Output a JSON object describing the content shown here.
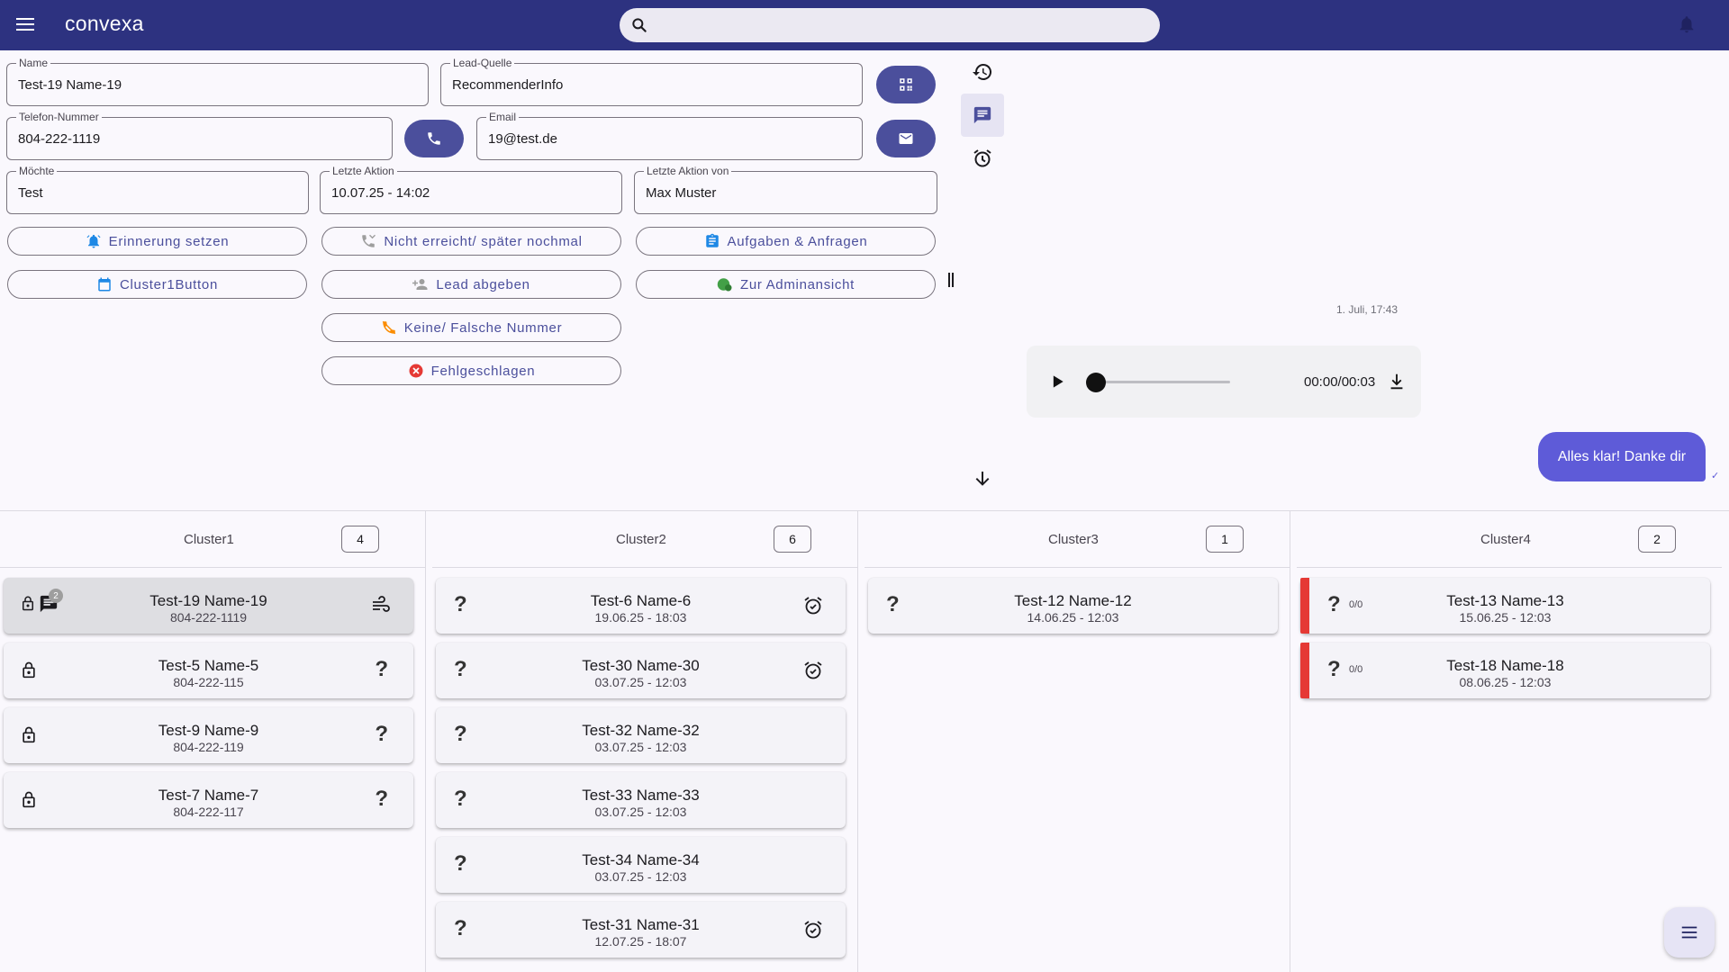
{
  "app": {
    "brand": "convexa"
  },
  "search": {
    "value": "",
    "placeholder": ""
  },
  "form": {
    "name_label": "Name",
    "name_value": "Test-19 Name-19",
    "lead_source_label": "Lead-Quelle",
    "lead_source_value": "RecommenderInfo",
    "phone_label": "Telefon-Nummer",
    "phone_value": "804-222-1119",
    "email_label": "Email",
    "email_value": "19@test.de",
    "wants_label": "Möchte",
    "wants_value": "Test",
    "last_action_label": "Letzte Aktion",
    "last_action_value": "10.07.25 - 14:02",
    "last_action_by_label": "Letzte Aktion von",
    "last_action_by_value": "Max Muster"
  },
  "actions": {
    "reminder": "Erinnerung setzen",
    "not_reached": "Nicht erreicht/ später nochmal",
    "tasks": "Aufgaben & Anfragen",
    "cluster1": "Cluster1Button",
    "hand_over": "Lead abgeben",
    "admin_view": "Zur Adminansicht",
    "wrong_number": "Keine/ Falsche Nummer",
    "failed": "Fehlgeschlagen"
  },
  "colors": {
    "reminder_icon": "#1e88e5",
    "tasks_icon": "#1e88e5",
    "calendar_icon": "#1e88e5",
    "admin_icon": "#43a047",
    "wrong_number_icon": "#fb8c00",
    "failed_icon": "#e53935",
    "primary": "#4b4f9c",
    "header": "#2d3280"
  },
  "chat": {
    "timestamp": "1. Juli, 17:43",
    "audio_time": "00:00/00:03",
    "audio_progress": 0,
    "message": "Alles klar! Danke dir",
    "read_mark": "✓"
  },
  "board": {
    "columns": [
      {
        "title": "Cluster1",
        "count": "4",
        "cards": [
          {
            "name": "Test-19 Name-19",
            "sub": "804-222-1119",
            "badge": "2"
          },
          {
            "name": "Test-5 Name-5",
            "sub": "804-222-115",
            "right": "?"
          },
          {
            "name": "Test-9 Name-9",
            "sub": "804-222-119",
            "right": "?"
          },
          {
            "name": "Test-7 Name-7",
            "sub": "804-222-117",
            "right": "?"
          }
        ]
      },
      {
        "title": "Cluster2",
        "count": "6",
        "cards": [
          {
            "left": "?",
            "name": "Test-6 Name-6",
            "sub": "19.06.25 - 18:03"
          },
          {
            "left": "?",
            "name": "Test-30 Name-30",
            "sub": "03.07.25 - 12:03"
          },
          {
            "left": "?",
            "name": "Test-32 Name-32",
            "sub": "03.07.25 - 12:03"
          },
          {
            "left": "?",
            "name": "Test-33 Name-33",
            "sub": "03.07.25 - 12:03"
          },
          {
            "left": "?",
            "name": "Test-34 Name-34",
            "sub": "03.07.25 - 12:03"
          },
          {
            "left": "?",
            "name": "Test-31 Name-31",
            "sub": "12.07.25 - 18:07"
          }
        ]
      },
      {
        "title": "Cluster3",
        "count": "1",
        "cards": [
          {
            "left": "?",
            "name": "Test-12 Name-12",
            "sub": "14.06.25 - 12:03"
          }
        ]
      },
      {
        "title": "Cluster4",
        "count": "2",
        "cards": [
          {
            "left": "?",
            "ratio": "0/0",
            "name": "Test-13 Name-13",
            "sub": "15.06.25 - 12:03"
          },
          {
            "left": "?",
            "ratio": "0/0",
            "name": "Test-18 Name-18",
            "sub": "08.06.25 - 12:03"
          }
        ]
      }
    ]
  }
}
